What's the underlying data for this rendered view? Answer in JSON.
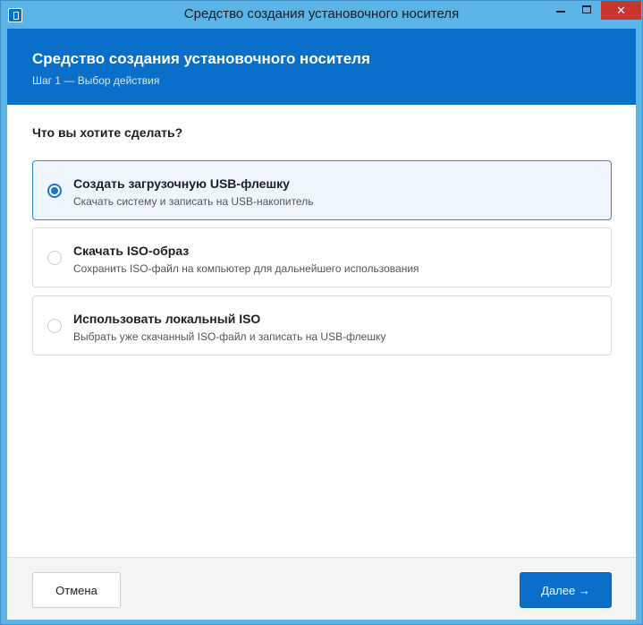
{
  "window": {
    "title": "Средство создания установочного носителя",
    "close_glyph": "✕"
  },
  "header": {
    "title": "Средство создания установочного носителя",
    "subtitle": "Шаг 1 — Выбор действия"
  },
  "main": {
    "question": "Что вы хотите сделать?",
    "options": [
      {
        "title": "Создать загрузочную USB-флешку",
        "description": "Скачать систему и записать на USB-накопитель",
        "selected": true
      },
      {
        "title": "Скачать ISO-образ",
        "description": "Сохранить ISO-файл на компьютер для дальнейшего использования",
        "selected": false
      },
      {
        "title": "Использовать локальный ISO",
        "description": "Выбрать уже скачанный ISO-файл и записать на USB-флешку",
        "selected": false
      }
    ]
  },
  "footer": {
    "cancel_label": "Отмена",
    "next_label": "Далее →"
  },
  "colors": {
    "titlebar": "#5ab4e8",
    "accent": "#0a6fc9",
    "close": "#c7372d",
    "selected_bg": "#eef5fd"
  },
  "icons": {
    "app": "usb-drive-icon"
  }
}
